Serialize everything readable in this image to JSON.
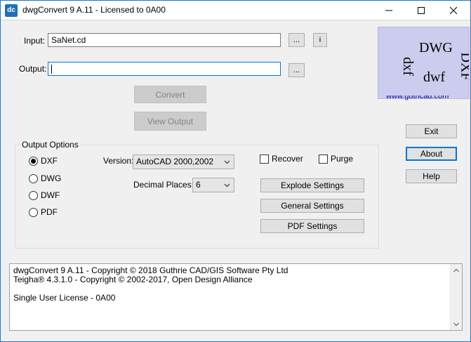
{
  "window": {
    "title": "dwgConvert 9 A.11 - Licensed to 0A00",
    "icon_text": "dc",
    "accent": "#0078d7"
  },
  "input": {
    "label": "Input:",
    "value": "SaNet.cd",
    "browse_label": "...",
    "info_label": "i"
  },
  "output": {
    "label": "Output:",
    "value": "",
    "browse_label": "..."
  },
  "actions": {
    "convert": "Convert",
    "view_output": "View Output"
  },
  "logo": {
    "words": [
      "DWG",
      "DXF",
      "dxf",
      "dwf"
    ],
    "url": "www.guthcad.com"
  },
  "side_buttons": {
    "exit": "Exit",
    "about": "About",
    "help": "Help"
  },
  "output_options": {
    "title": "Output Options",
    "formats": [
      {
        "label": "DXF",
        "selected": true
      },
      {
        "label": "DWG",
        "selected": false
      },
      {
        "label": "DWF",
        "selected": false
      },
      {
        "label": "PDF",
        "selected": false
      }
    ],
    "version_label": "Version:",
    "version_value": "AutoCAD 2000,2002",
    "decimal_label": "Decimal Places:",
    "decimal_value": "6",
    "recover_label": "Recover",
    "purge_label": "Purge",
    "explode_settings": "Explode Settings",
    "general_settings": "General Settings",
    "pdf_settings": "PDF Settings"
  },
  "log": {
    "lines": [
      "dwgConvert 9 A.11 - Copyright © 2018 Guthrie CAD/GIS Software Pty Ltd",
      "Teigha® 4.3.1.0 - Copyright © 2002-2017, Open Design Alliance",
      "",
      "Single User License - 0A00"
    ]
  }
}
